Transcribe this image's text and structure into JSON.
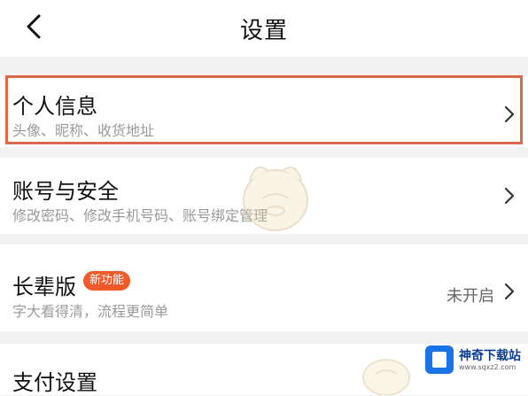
{
  "header": {
    "title": "设置",
    "back_icon": "chevron-left-icon"
  },
  "settings": [
    {
      "title": "个人信息",
      "subtitle": "头像、昵称、收货地址",
      "highlighted": true,
      "chevron_icon": "chevron-right-icon"
    },
    {
      "title": "账号与安全",
      "subtitle": "修改密码、修改手机号码、账号绑定管理",
      "chevron_icon": "chevron-right-icon"
    },
    {
      "title": "长辈版",
      "badge": "新功能",
      "subtitle": "字大看得清，流程更简单",
      "status": "未开启",
      "chevron_icon": "chevron-right-icon"
    },
    {
      "title": "支付设置"
    }
  ],
  "watermark": {
    "brand": "神奇下载站",
    "url": "www.sqxz2.com"
  },
  "colors": {
    "highlight": "#dc6a4a",
    "badge": "#f05a2a",
    "logo": "#1a73e8"
  }
}
